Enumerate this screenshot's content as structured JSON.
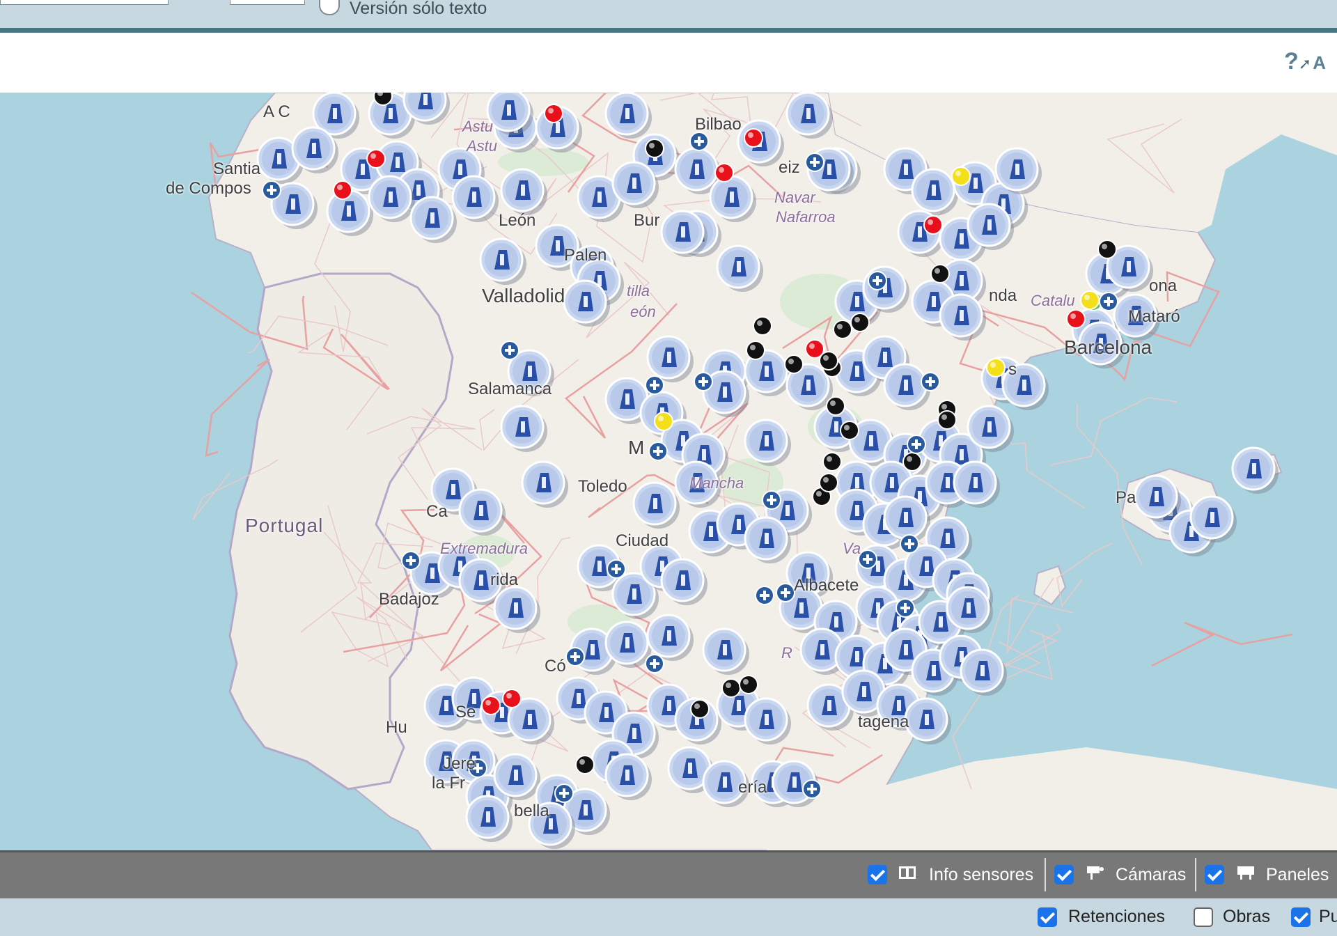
{
  "topbar": {
    "text_only_label": "Versión sólo texto"
  },
  "header": {
    "help_icon": "help-question-pointer-icon",
    "help_trailing_letter": "A"
  },
  "map": {
    "place_labels": {
      "a_coruna": "A C",
      "santiago_1": "Santia",
      "santiago_2": "de Compos",
      "bilbao": "Bilbao",
      "asturias_1": "Astu",
      "asturias_2": "Astu",
      "leon": "León",
      "burgos": "Bur",
      "palencia": "Palen",
      "valladolid": "Valladolid",
      "castilla_1": "tilla",
      "castilla_2": "eón",
      "navarra_1": "Navar",
      "navarra_2": "Nafarroa",
      "vitoria": "eiz",
      "lleida": "nda",
      "catalunya": "Catalu",
      "girona": "ona",
      "mataro": "Mataró",
      "barcelona": "Barcelona",
      "salamanca": "Salamanca",
      "madrid": "M",
      "toledo": "Toledo",
      "mancha": "Mancha",
      "caceres": "Ca",
      "portugal": "Portugal",
      "extremadura": "Extremadura",
      "merida": "rida",
      "badajoz": "Badajoz",
      "ciudad_real": "Ciudad",
      "valencia": "Va",
      "albacete": "Albacete",
      "cordoba": "Có",
      "huelva": "Hu",
      "jerez_1": "Jere",
      "jerez_2": "la Fr",
      "sevilla": "Se",
      "marbella": "bella",
      "murcia_region": "R",
      "cartagena": "tagena",
      "palma": "Pa",
      "almeria": "ería",
      "tarragona": "s"
    }
  },
  "legend": {
    "items": [
      {
        "label": "Info sensores",
        "checked": true,
        "icon": "sensor-info-icon"
      },
      {
        "label": "Cámaras",
        "checked": true,
        "icon": "camera-icon"
      },
      {
        "label": "Paneles",
        "checked": true,
        "icon": "panel-sign-icon"
      }
    ]
  },
  "filters": {
    "items": [
      {
        "label": "Retenciones",
        "checked": true
      },
      {
        "label": "Obras",
        "checked": false
      },
      {
        "label": "Pu",
        "checked": true
      }
    ]
  },
  "colors": {
    "sea": "#aad3df",
    "land": "#f2efe9",
    "marker_fill": "#c9d7f0",
    "marker_icon": "#2a4fa6",
    "legend_bar": "#787878",
    "accent_check": "#1a73e8",
    "incident_red": "#e8101a",
    "incident_black": "#111111",
    "incident_yellow": "#f3e01a"
  }
}
